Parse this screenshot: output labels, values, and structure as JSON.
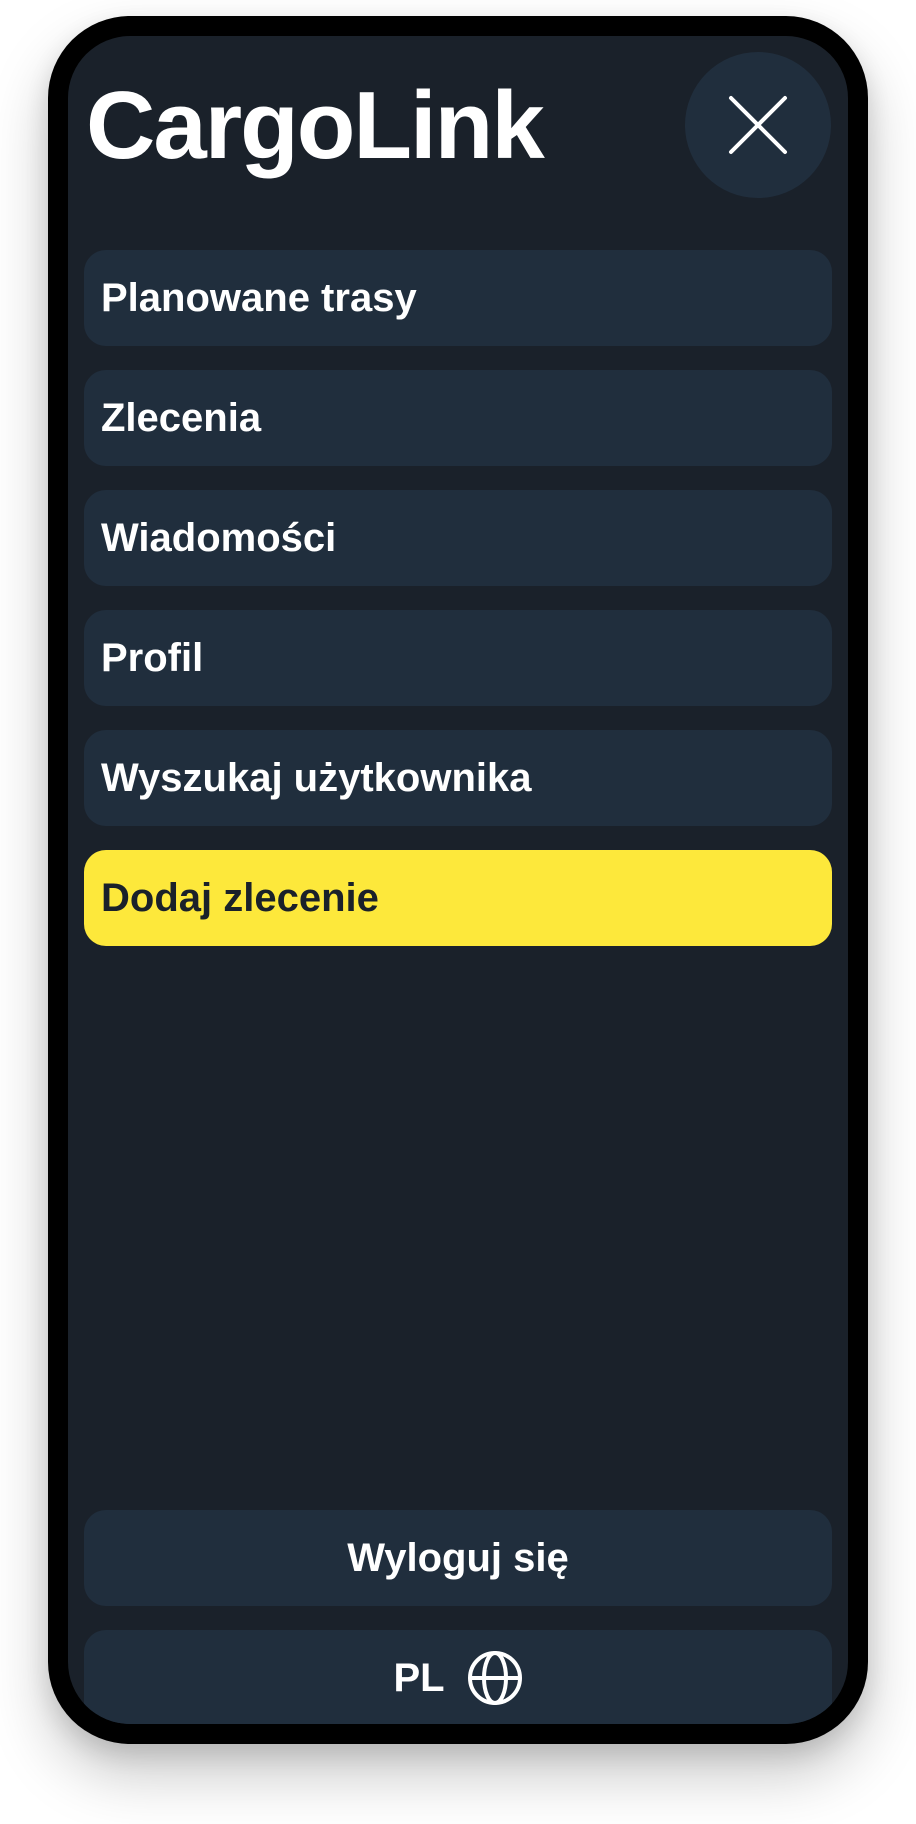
{
  "app": {
    "title": "CargoLink"
  },
  "header": {
    "close_icon": "close-icon"
  },
  "menu": {
    "items": [
      {
        "label": "Planowane trasy"
      },
      {
        "label": "Zlecenia"
      },
      {
        "label": "Wiadomości"
      },
      {
        "label": "Profil"
      },
      {
        "label": "Wyszukaj użytkownika"
      },
      {
        "label": "Dodaj zlecenie"
      }
    ]
  },
  "footer": {
    "logout_label": "Wyloguj się",
    "language_label": "PL",
    "language_icon": "globe-icon"
  },
  "colors": {
    "background": "#1a212a",
    "surface": "#202e3d",
    "accent": "#fde83b",
    "text": "#ffffff"
  }
}
